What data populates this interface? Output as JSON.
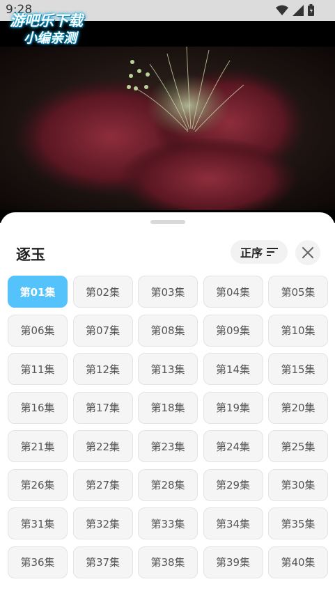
{
  "status_bar": {
    "time": "9:28"
  },
  "watermark": {
    "line1": "游吧乐下载",
    "line2": "小编亲测"
  },
  "sheet": {
    "title": "逐玉",
    "sort_label": "正序",
    "active_index": 0,
    "episodes": [
      "第01集",
      "第02集",
      "第03集",
      "第04集",
      "第05集",
      "第06集",
      "第07集",
      "第08集",
      "第09集",
      "第10集",
      "第11集",
      "第12集",
      "第13集",
      "第14集",
      "第15集",
      "第16集",
      "第17集",
      "第18集",
      "第19集",
      "第20集",
      "第21集",
      "第22集",
      "第23集",
      "第24集",
      "第25集",
      "第26集",
      "第27集",
      "第28集",
      "第29集",
      "第30集",
      "第31集",
      "第32集",
      "第33集",
      "第34集",
      "第35集",
      "第36集",
      "第37集",
      "第38集",
      "第39集",
      "第40集"
    ]
  },
  "colors": {
    "accent": "#55c3fb"
  }
}
